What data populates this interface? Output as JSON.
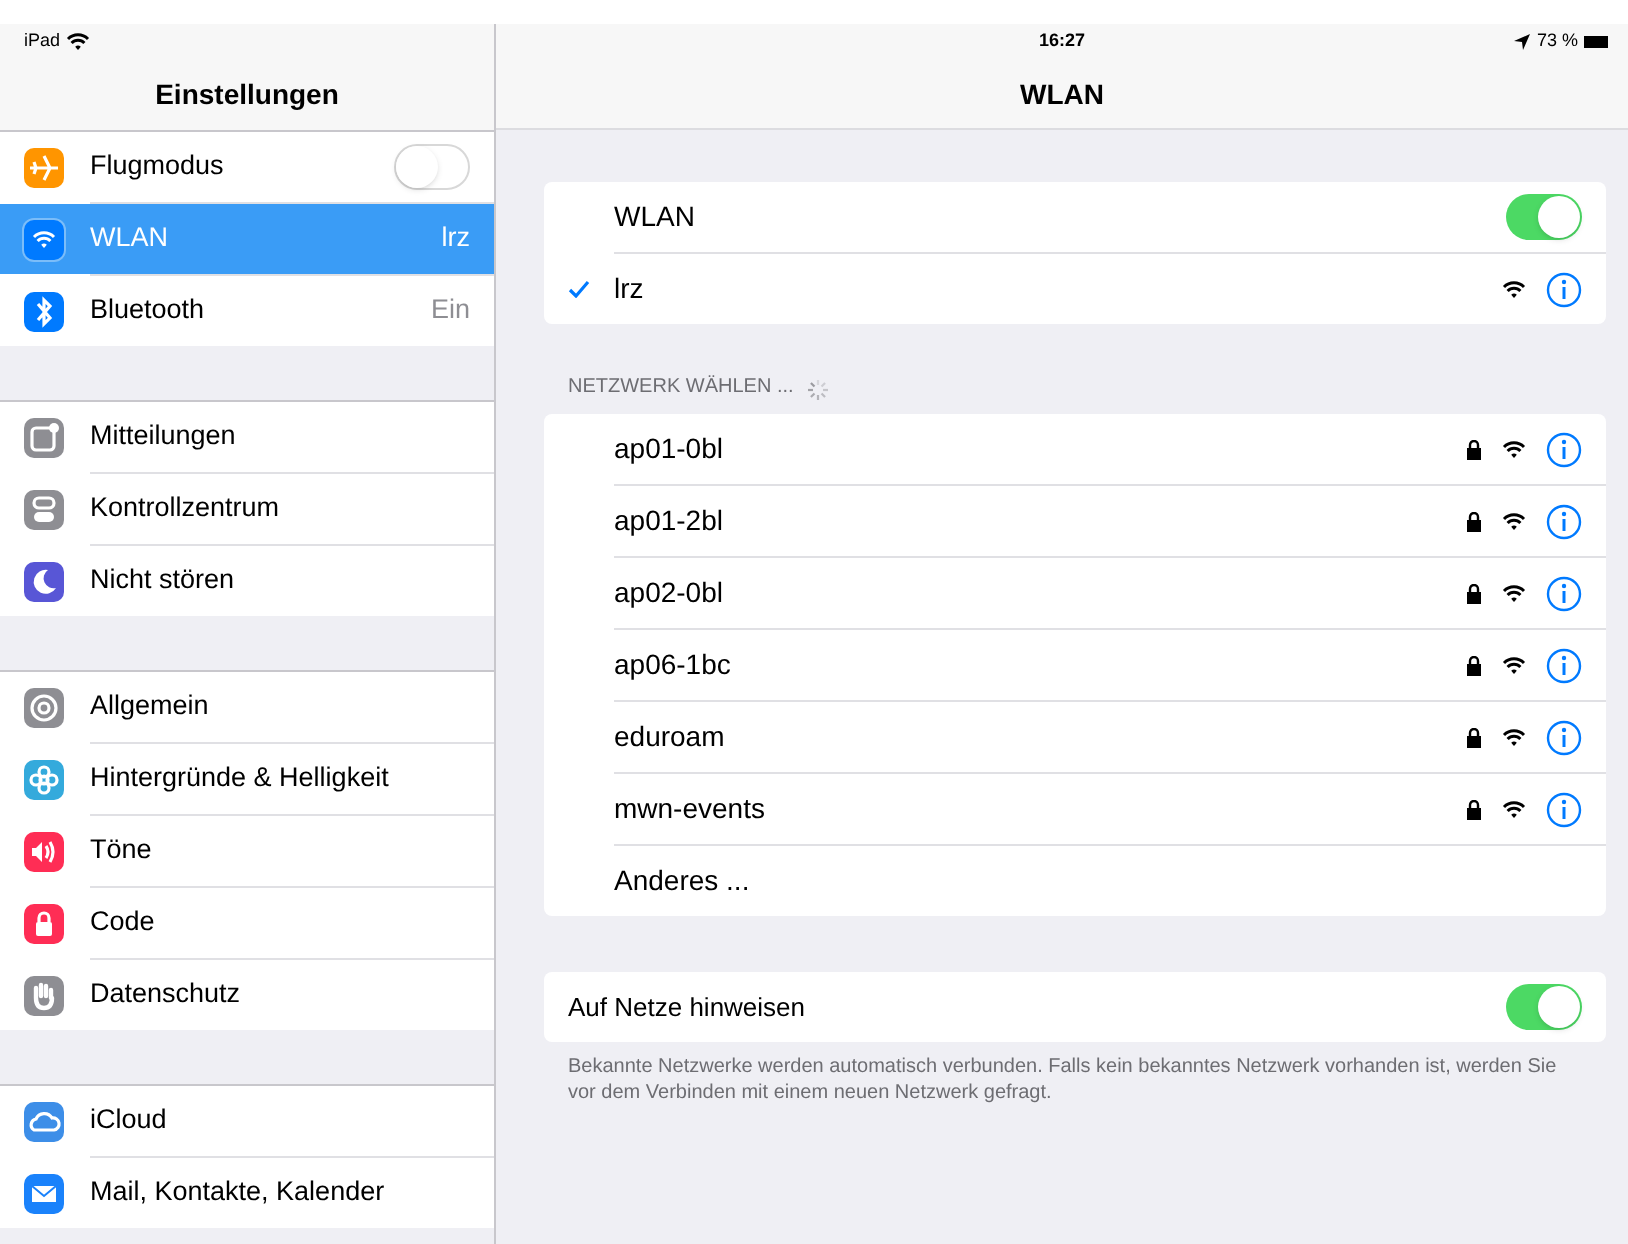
{
  "status_bar": {
    "device": "iPad",
    "time": "16:27",
    "battery": "73 %"
  },
  "sidebar": {
    "title": "Einstellungen",
    "groups": [
      [
        {
          "label": "Flugmodus",
          "kind": "toggle",
          "on": false,
          "selected": false,
          "color": "#ff9500"
        },
        {
          "label": "WLAN",
          "kind": "value",
          "value": "lrz",
          "selected": true,
          "color": "#007aff"
        },
        {
          "label": "Bluetooth",
          "kind": "value",
          "value": "Ein",
          "selected": false,
          "color": "#007aff"
        }
      ],
      [
        {
          "label": "Mitteilungen",
          "kind": "nav",
          "selected": false,
          "color": "#8e8e93"
        },
        {
          "label": "Kontrollzentrum",
          "kind": "nav",
          "selected": false,
          "color": "#8e8e93"
        },
        {
          "label": "Nicht stören",
          "kind": "nav",
          "selected": false,
          "color": "#5856d6"
        }
      ],
      [
        {
          "label": "Allgemein",
          "kind": "nav",
          "selected": false,
          "color": "#8e8e93"
        },
        {
          "label": "Hintergründe & Helligkeit",
          "kind": "nav",
          "selected": false,
          "color": "#34aadc"
        },
        {
          "label": "Töne",
          "kind": "nav",
          "selected": false,
          "color": "#ff2d55"
        },
        {
          "label": "Code",
          "kind": "nav",
          "selected": false,
          "color": "#ff2d55"
        },
        {
          "label": "Datenschutz",
          "kind": "nav",
          "selected": false,
          "color": "#8e8e93"
        }
      ],
      [
        {
          "label": "iCloud",
          "kind": "nav",
          "selected": false,
          "color": "#3d8ee8"
        },
        {
          "label": "Mail, Kontakte, Kalender",
          "kind": "nav",
          "selected": false,
          "color": "#1a82fb"
        }
      ]
    ]
  },
  "detail": {
    "title": "WLAN",
    "wlan": {
      "label": "WLAN",
      "on": true,
      "connected": {
        "name": "lrz",
        "locked": false
      }
    },
    "networks_header": "NETZWERK WÄHLEN ...",
    "networks": [
      {
        "kind": "network",
        "name": "ap01-0bl",
        "locked": true
      },
      {
        "kind": "network",
        "name": "ap01-2bl",
        "locked": true
      },
      {
        "kind": "network",
        "name": "ap02-0bl",
        "locked": true
      },
      {
        "kind": "network",
        "name": "ap06-1bc",
        "locked": true
      },
      {
        "kind": "network",
        "name": "eduroam",
        "locked": true
      },
      {
        "kind": "network",
        "name": "mwn-events",
        "locked": true
      },
      {
        "kind": "other",
        "name": "Anderes ..."
      }
    ],
    "ask_to_join": {
      "label": "Auf Netze hinweisen",
      "on": true
    },
    "footnote": "Bekannte Netzwerke werden automatisch verbunden. Falls kein bekanntes Netzwerk vorhanden ist, werden Sie vor dem Verbinden mit einem neuen Netzwerk gefragt."
  }
}
